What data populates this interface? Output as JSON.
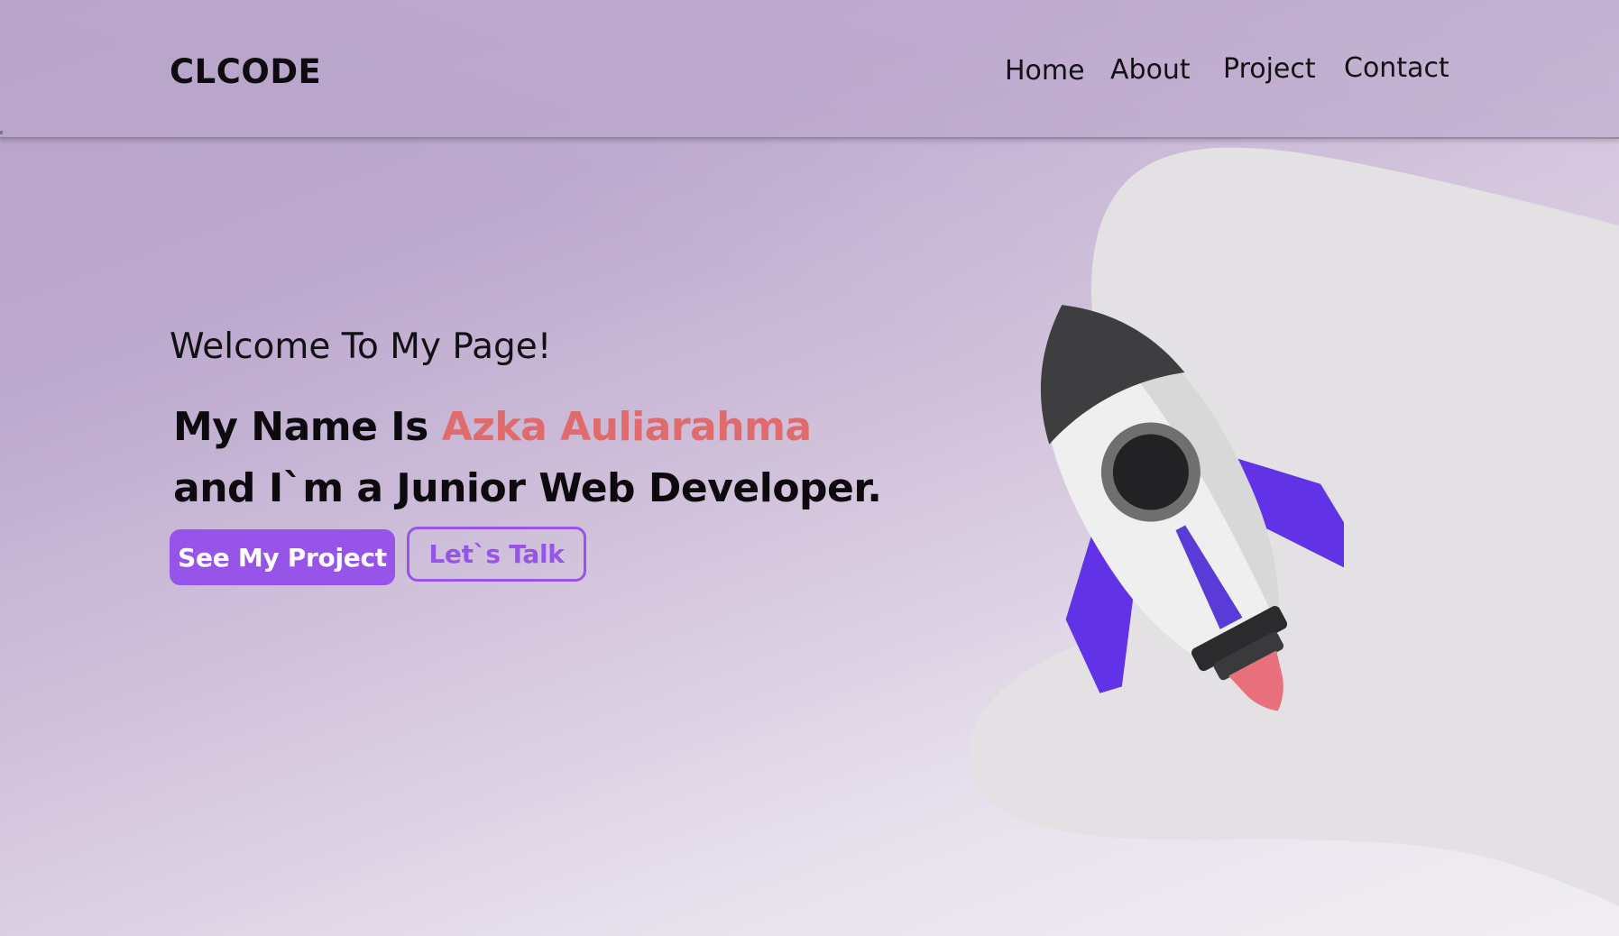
{
  "header": {
    "logo": "CLCODE",
    "nav": {
      "home": "Home",
      "about": "About",
      "project": "Project",
      "contact": "Contact"
    }
  },
  "hero": {
    "welcome": "Welcome To My Page!",
    "line1_prefix": "My Name Is ",
    "name": "Azka Auliarahma",
    "line2": "and I`m a Junior Web Developer.",
    "primary_button": "See My Project",
    "secondary_button": "Let`s Talk"
  },
  "colors": {
    "accent": "#9655e8",
    "name_highlight": "#e06b6c",
    "background_start": "#b9a4cb",
    "background_end": "#f0eef2",
    "blob": "#e3e1e4"
  },
  "icons": {
    "hero_illustration": "rocket-illustration"
  }
}
